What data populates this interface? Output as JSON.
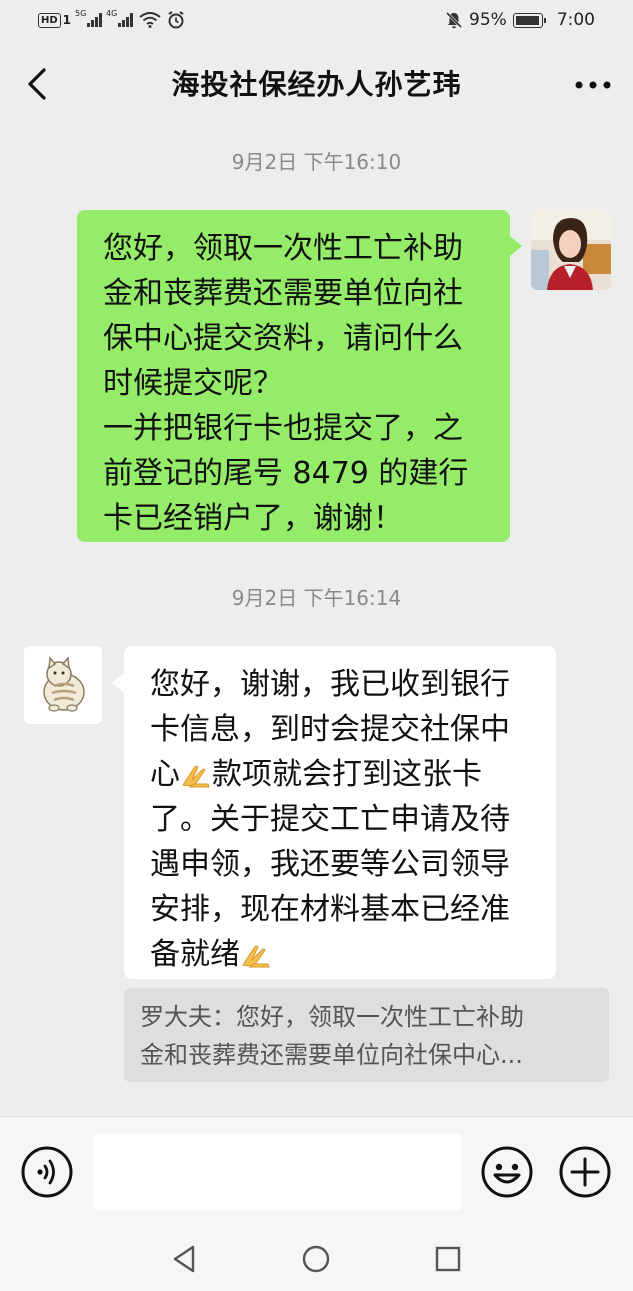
{
  "status_bar": {
    "hd": "HD",
    "sim1": "1",
    "sig1_gen": "5G",
    "sig2_gen": "4G",
    "battery_percent": "95%",
    "battery_level": 0.95,
    "time": "7:00",
    "icons": [
      "wifi-icon",
      "alarm-icon",
      "mute-icon",
      "battery-icon"
    ]
  },
  "header": {
    "title": "海投社保经办人孙艺玮",
    "back_icon": "chevron-left-icon",
    "more_icon": "more-dots-icon"
  },
  "messages": [
    {
      "timestamp": "9月2日 下午16:10",
      "direction": "outgoing",
      "lines": [
        "您好，领取一次性工亡补助",
        "金和丧葬费还需要单位向社",
        "保中心提交资料，请问什么",
        "时候提交呢？",
        "一并把银行卡也提交了，之",
        "前登记的尾号 8479 的建行",
        "卡已经销户了，谢谢！"
      ]
    },
    {
      "timestamp": "9月2日 下午16:14",
      "direction": "incoming",
      "lines": [
        "您好，谢谢，我已收到银行",
        "卡信息，到时会提交社保中",
        {
          "before": "心",
          "emoji": "pray-hands-emoji",
          "after": "款项就会打到这张卡"
        },
        "了。关于提交工亡申请及待",
        "遇申领，我还要等公司领导",
        "安排，现在材料基本已经准",
        {
          "before": "备就绪",
          "emoji": "pray-hands-emoji",
          "after": ""
        }
      ],
      "quote": {
        "line1": "罗大夫：您好，领取一次性工亡补助",
        "line2": "金和丧葬费还需要单位向社保中心..."
      }
    }
  ],
  "input_bar": {
    "text_value": "",
    "voice_icon": "voice-icon",
    "emoji_icon": "smiley-icon",
    "plus_icon": "plus-icon"
  },
  "nav_bar": {
    "icons": [
      "back-triangle-icon",
      "home-circle-icon",
      "recents-square-icon"
    ]
  },
  "colors": {
    "background": "#ededed",
    "outgoing_bubble": "#95ec69",
    "incoming_bubble": "#ffffff",
    "timestamp_text": "#8a8a8a",
    "quote_bg": "#dedede"
  }
}
